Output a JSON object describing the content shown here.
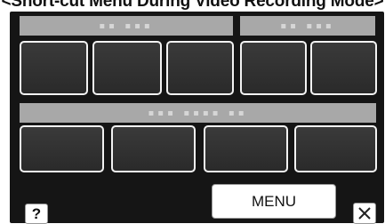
{
  "caption": "<Short-cut Menu During Video Recording Mode>",
  "headers": {
    "top_left": "▪▪ ▪▪▪",
    "top_right": "▪▪ ▪▪▪",
    "middle": "▪▪▪ ▪▪▪▪ ▪▪"
  },
  "buttons": {
    "help_label": "?",
    "menu_label": "MENU",
    "close_icon": "close-icon"
  }
}
